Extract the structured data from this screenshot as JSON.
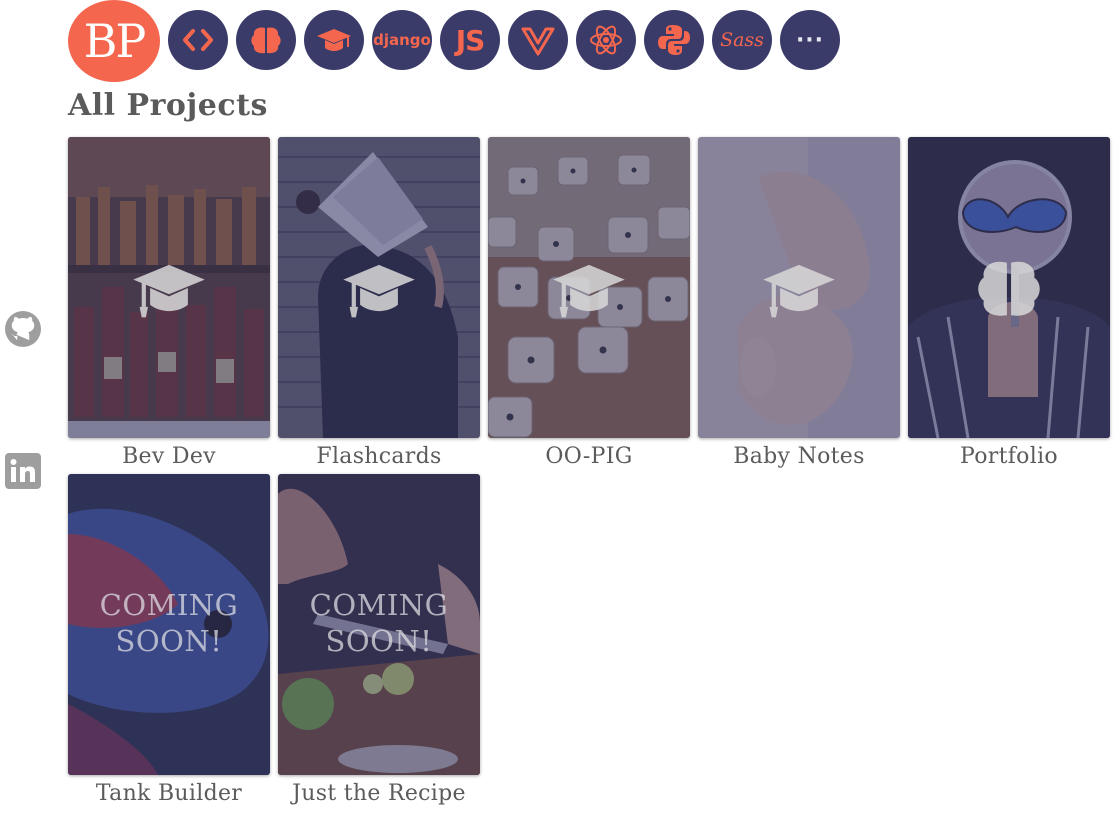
{
  "brand": {
    "initials": "BP",
    "color": "#f4664e"
  },
  "colors": {
    "accent": "#f4664e",
    "nav_circle": "#3a3b69",
    "overlay": "#3a3b69"
  },
  "nav_icons": [
    {
      "name": "code-icon"
    },
    {
      "name": "brain-icon"
    },
    {
      "name": "graduation-cap-icon"
    },
    {
      "name": "django-icon",
      "label": "django"
    },
    {
      "name": "javascript-icon",
      "label": "JS"
    },
    {
      "name": "vue-icon"
    },
    {
      "name": "react-icon"
    },
    {
      "name": "python-icon"
    },
    {
      "name": "sass-icon",
      "label": "Sass"
    },
    {
      "name": "more-icon",
      "label": "···"
    }
  ],
  "heading": "All Projects",
  "social": [
    {
      "name": "github-icon"
    },
    {
      "name": "linkedin-icon"
    }
  ],
  "projects": [
    {
      "title": "Bev Dev",
      "badge": "graduation-cap-icon"
    },
    {
      "title": "Flashcards",
      "badge": "graduation-cap-icon"
    },
    {
      "title": "OO-PIG",
      "badge": "graduation-cap-icon"
    },
    {
      "title": "Baby Notes",
      "badge": "graduation-cap-icon"
    },
    {
      "title": "Portfolio",
      "badge": "brain-icon"
    },
    {
      "title": "Tank Builder",
      "status": "COMING SOON!"
    },
    {
      "title": "Just the Recipe",
      "status": "COMING SOON!"
    }
  ]
}
